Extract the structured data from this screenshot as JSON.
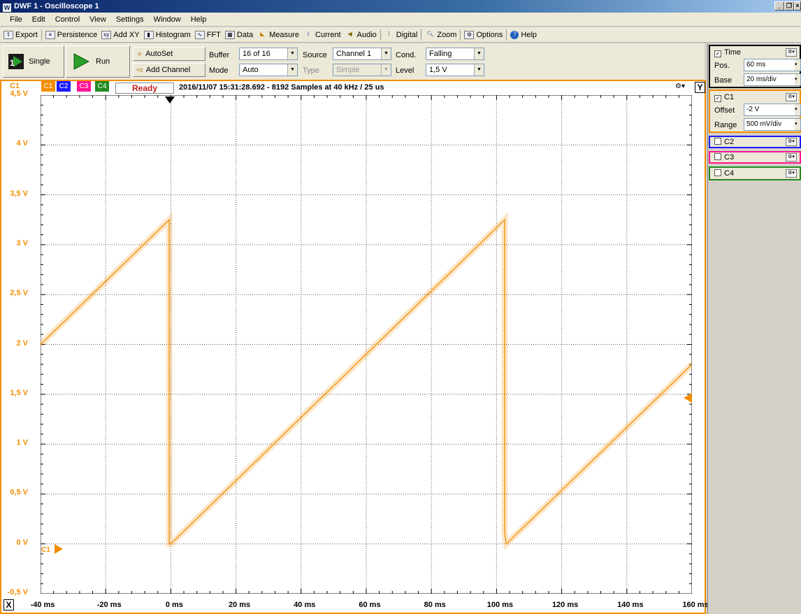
{
  "titlebar": {
    "title": "DWF 1 - Oscilloscope 1",
    "icon": "W",
    "buttons": [
      "_",
      "❐",
      "×"
    ]
  },
  "menu": [
    "File",
    "Edit",
    "Control",
    "View",
    "Settings",
    "Window",
    "Help"
  ],
  "toolbar": [
    "Export",
    "Persistence",
    "Add XY",
    "Histogram",
    "FFT",
    "Data",
    "Measure",
    "Current",
    "Audio",
    "Digital",
    "Zoom",
    "Options",
    "Help"
  ],
  "controls": {
    "single": "Single",
    "run": "Run",
    "autoset": "AutoSet",
    "add_channel": "Add Channel",
    "buffer_label": "Buffer",
    "buffer_value": "16 of 16",
    "mode_label": "Mode",
    "mode_value": "Auto",
    "source_label": "Source",
    "source_value": "Channel 1",
    "type_label": "Type",
    "type_value": "Simple",
    "cond_label": "Cond.",
    "cond_value": "Falling",
    "level_label": "Level",
    "level_value": "1,5 V"
  },
  "scope": {
    "channel_label": "C1",
    "channel_tabs": [
      "C1",
      "C2",
      "C3",
      "C4"
    ],
    "status": "Ready",
    "acq_info": "2016/11/07 15:31:28.692 - 8192 Samples at 40 kHz / 25 us",
    "x_button": "X",
    "y_button": "Y",
    "marker_label": "C1",
    "colors": {
      "c1": "#f28e00",
      "c2": "#1a1aff",
      "c3": "#ff1493",
      "c4": "#228b22"
    }
  },
  "chart_data": {
    "type": "line",
    "x_ticks": [
      "-40 ms",
      "-20 ms",
      "0 ms",
      "20 ms",
      "40 ms",
      "60 ms",
      "80 ms",
      "100 ms",
      "120 ms",
      "140 ms",
      "160 ms"
    ],
    "y_ticks": [
      "4,5 V",
      "4 V",
      "3,5 V",
      "3 V",
      "2,5 V",
      "2 V",
      "1,5 V",
      "1 V",
      "0,5 V",
      "0 V",
      "-0,5 V"
    ],
    "xlim": [
      -40,
      160
    ],
    "ylim": [
      -0.5,
      4.5
    ],
    "grid": true,
    "series": [
      {
        "color": "#f28e00",
        "x": [
          -40,
          -0.5,
          -0.5,
          0,
          102.5,
          102.5,
          103,
          160
        ],
        "y": [
          2.0,
          3.25,
          0.0,
          0.0,
          3.25,
          0.1,
          0.0,
          1.8
        ]
      }
    ],
    "trigger_time_ms": 0,
    "trigger_level_v": 1.5
  },
  "panel": {
    "time_label": "Time",
    "pos_label": "Pos.",
    "pos_value": "60 ms",
    "base_label": "Base",
    "base_value": "20 ms/div",
    "c1_label": "C1",
    "offset_label": "Offset",
    "offset_value": "-2 V",
    "range_label": "Range",
    "range_value": "500 mV/div",
    "c2_label": "C2",
    "c3_label": "C3",
    "c4_label": "C4"
  }
}
